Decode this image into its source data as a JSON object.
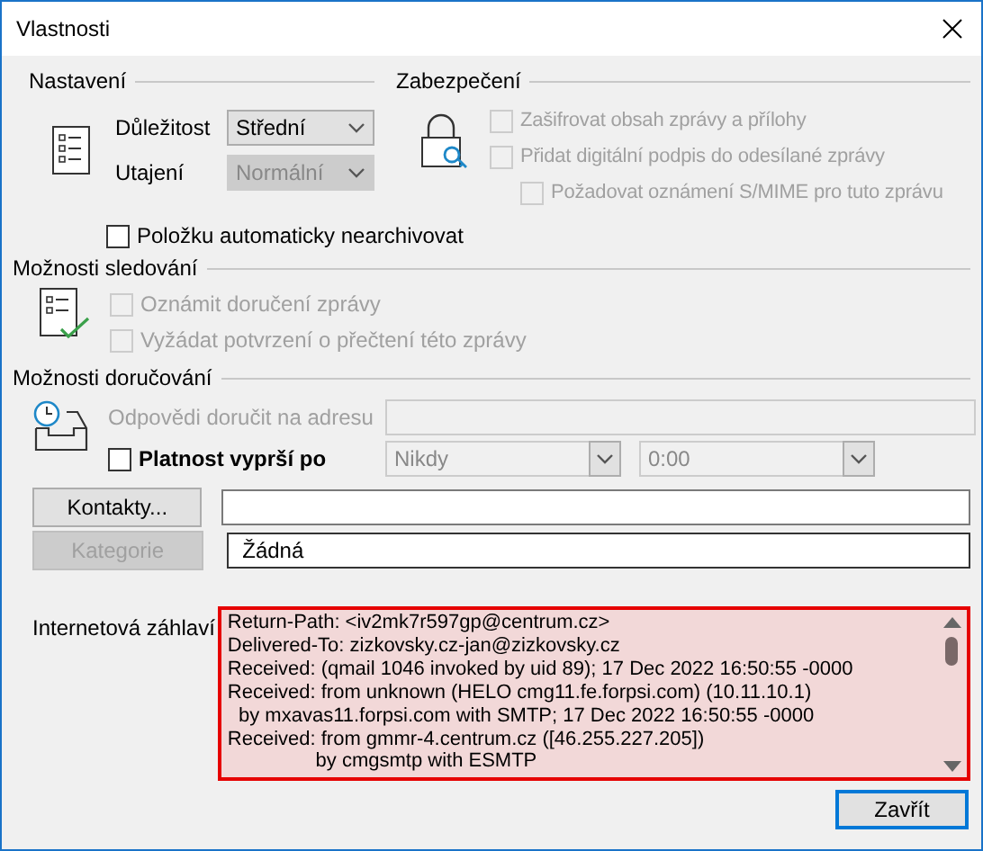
{
  "window": {
    "title": "Vlastnosti"
  },
  "settings": {
    "heading": "Nastavení",
    "fields": [
      {
        "label": "Důležitost",
        "value": "Střední",
        "disabled": false
      },
      {
        "label": "Utajení",
        "value": "Normální",
        "disabled": true
      }
    ],
    "autoarchive": {
      "label": "Položku automaticky nearchivovat",
      "checked": false,
      "disabled": false
    }
  },
  "security": {
    "heading": "Zabezpečení",
    "options": [
      {
        "label": "Zašifrovat obsah zprávy a přílohy",
        "checked": false,
        "disabled": true
      },
      {
        "label": "Přidat digitální podpis do odesílané zprávy",
        "checked": false,
        "disabled": true,
        "children": [
          {
            "label": "Požadovat oznámení S/MIME pro tuto zprávu",
            "checked": false,
            "disabled": true
          }
        ]
      }
    ]
  },
  "tracking": {
    "heading": "Možnosti sledování",
    "options": [
      {
        "label": "Oznámit doručení zprávy",
        "checked": false,
        "disabled": true
      },
      {
        "label": "Vyžádat potvrzení o přečtení této zprávy",
        "checked": false,
        "disabled": true
      }
    ]
  },
  "delivery": {
    "heading": "Možnosti doručování",
    "reply_to": {
      "label": "Odpovědi doručit na adresu",
      "disabled": true
    },
    "expires": {
      "label": "Platnost vyprší po",
      "checked": false,
      "disabled": false,
      "date": "Nikdy",
      "time": "0:00"
    }
  },
  "contacts": {
    "button": "Kontakty...",
    "disabled": false
  },
  "categories": {
    "button": "Kategorie",
    "disabled": true,
    "value": "Žádná"
  },
  "headers": {
    "label": "Internetová záhlaví",
    "lines": [
      "Return-Path: <iv2mk7r597gp@centrum.cz>",
      "Delivered-To: zizkovsky.cz-jan@zizkovsky.cz",
      "Received: (qmail 1046 invoked by uid 89); 17 Dec 2022 16:50:55 -0000",
      "Received: from unknown (HELO cmg11.fe.forpsi.com) (10.11.10.1)",
      "  by mxavas11.forpsi.com with SMTP; 17 Dec 2022 16:50:55 -0000",
      "Received: from gmmr-4.centrum.cz ([46.255.227.205])",
      "                by cmgsmtp with ESMTP"
    ]
  },
  "buttons": [
    {
      "label": "Zavřít",
      "default": true
    }
  ]
}
